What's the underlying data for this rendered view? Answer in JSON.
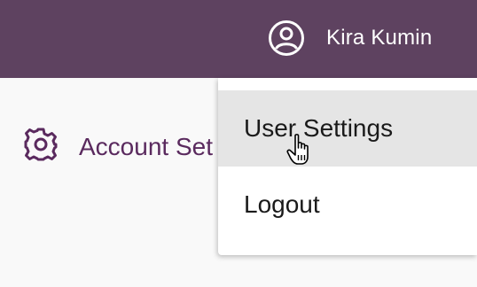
{
  "header": {
    "user_name": "Kira Kumin",
    "user_icon": "user-circle-icon",
    "background": "#5e4260"
  },
  "main": {
    "settings_label": "Account Set",
    "settings_icon": "gear-icon",
    "accent": "#5a2a5e"
  },
  "dropdown": {
    "items": [
      {
        "label": "User Settings",
        "hovered": true
      },
      {
        "label": "Logout",
        "hovered": false
      }
    ]
  }
}
